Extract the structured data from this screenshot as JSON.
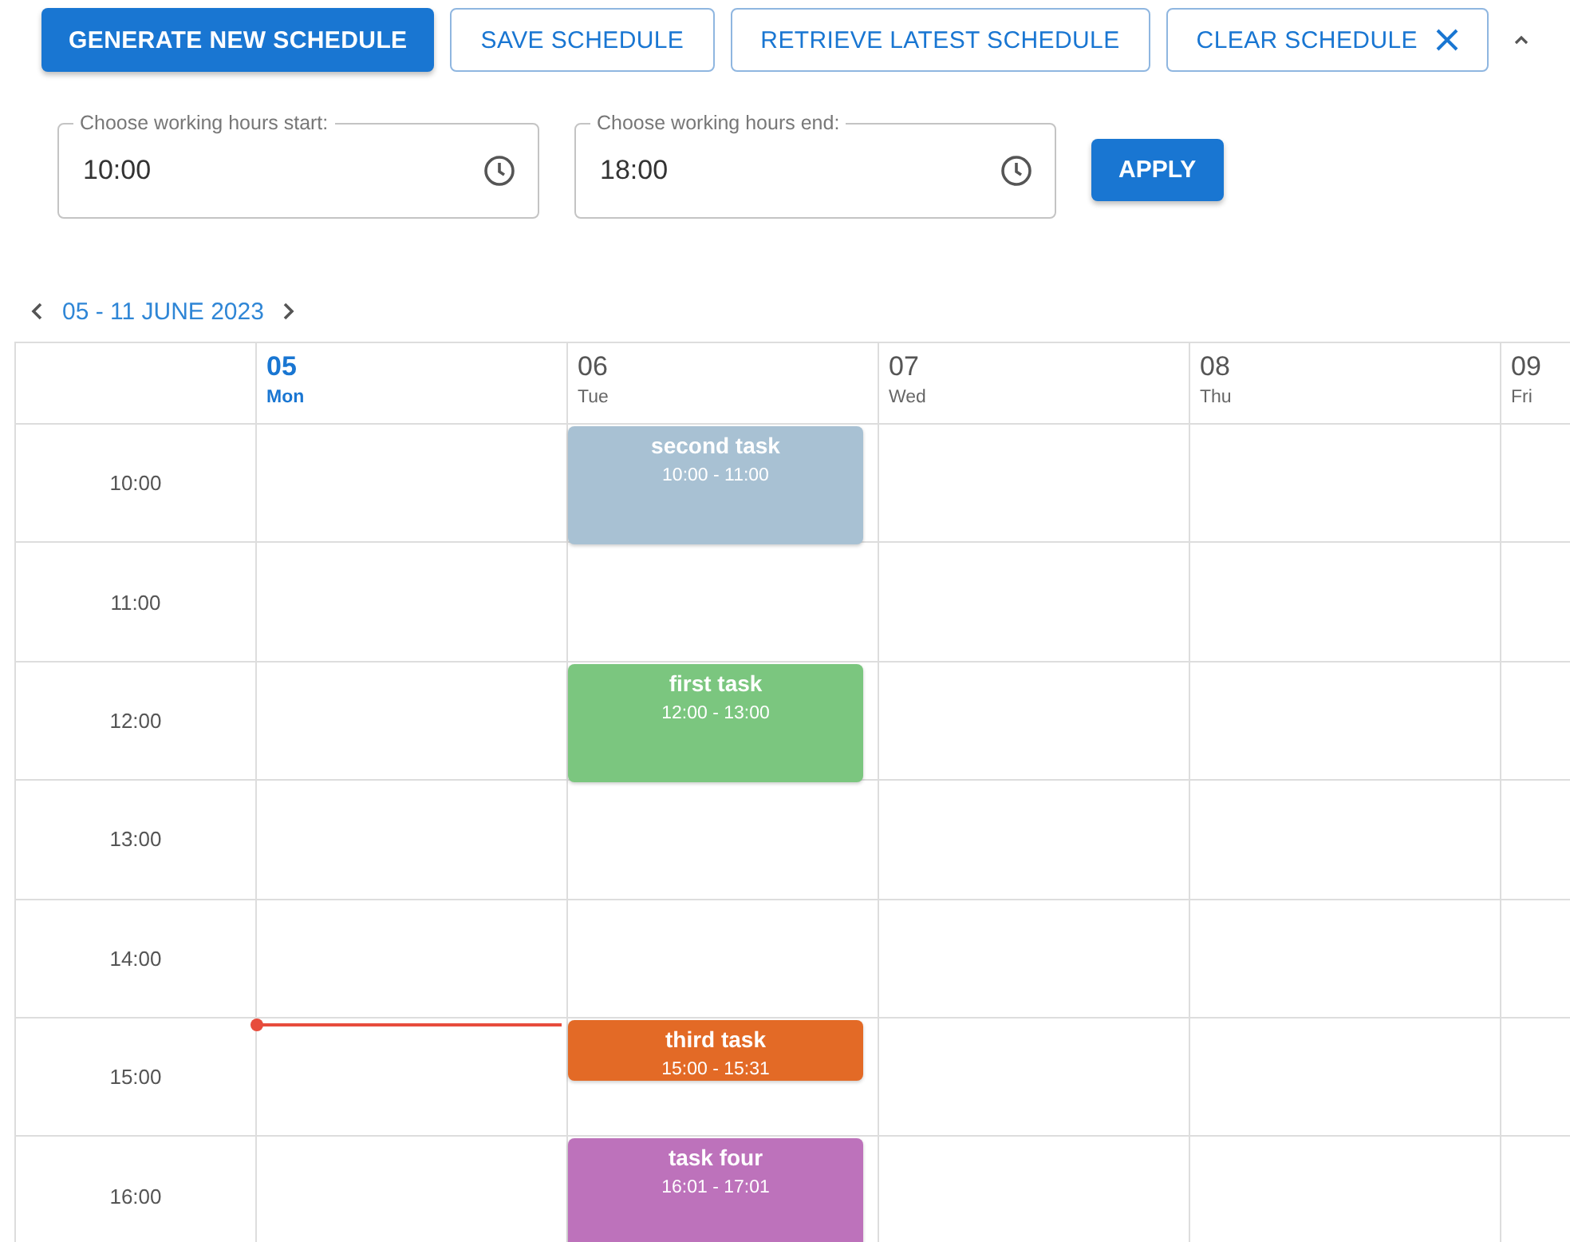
{
  "toolbar": {
    "buttons": [
      {
        "label": "GENERATE NEW SCHEDULE",
        "kind": "primary"
      },
      {
        "label": "SAVE SCHEDULE",
        "kind": "outlined"
      },
      {
        "label": "RETRIEVE LATEST SCHEDULE",
        "kind": "outlined"
      },
      {
        "label": "CLEAR SCHEDULE",
        "kind": "clear"
      }
    ]
  },
  "hours_form": {
    "fields": [
      {
        "label": "Choose working hours start:",
        "value": "10:00"
      },
      {
        "label": "Choose working hours end:",
        "value": "18:00"
      }
    ],
    "apply": "APPLY"
  },
  "calendar": {
    "range": "05 - 11 JUNE 2023",
    "days": [
      {
        "date": "05",
        "weekday": "Mon",
        "selected": true
      },
      {
        "date": "06",
        "weekday": "Tue",
        "selected": false
      },
      {
        "date": "07",
        "weekday": "Wed",
        "selected": false
      },
      {
        "date": "08",
        "weekday": "Thu",
        "selected": false
      },
      {
        "date": "09",
        "weekday": "Fri",
        "selected": false
      }
    ],
    "rows": [
      {
        "time": "10:00",
        "now": false,
        "cells": [
          {},
          {
            "event": {
              "title": "second task",
              "time": "10:00 - 11:00",
              "color": "#a8c1d3",
              "kind": "hour"
            }
          },
          {},
          {},
          {}
        ]
      },
      {
        "time": "11:00",
        "now": false,
        "cells": [
          {},
          {},
          {},
          {},
          {}
        ]
      },
      {
        "time": "12:00",
        "now": false,
        "cells": [
          {},
          {
            "event": {
              "title": "first task",
              "time": "12:00 - 13:00",
              "color": "#7bc67f",
              "kind": "hour"
            }
          },
          {},
          {},
          {}
        ]
      },
      {
        "time": "13:00",
        "now": false,
        "cells": [
          {},
          {},
          {},
          {},
          {}
        ]
      },
      {
        "time": "14:00",
        "now": false,
        "cells": [
          {},
          {},
          {},
          {},
          {}
        ]
      },
      {
        "time": "15:00",
        "now": true,
        "cells": [
          {},
          {
            "event": {
              "title": "third task",
              "time": "15:00 - 15:31",
              "color": "#e36a26",
              "kind": "half"
            }
          },
          {},
          {},
          {}
        ]
      },
      {
        "time": "16:00",
        "now": false,
        "cells": [
          {},
          {
            "event": {
              "title": "task four",
              "time": "16:01 - 17:01",
              "color": "#bd72bb",
              "kind": "hour"
            }
          },
          {},
          {},
          {}
        ]
      }
    ]
  }
}
